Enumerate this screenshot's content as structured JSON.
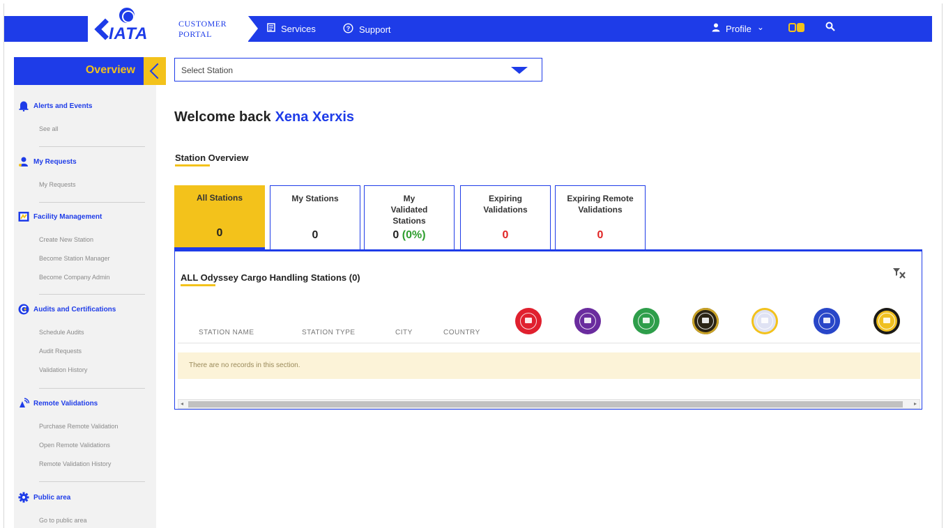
{
  "header": {
    "logo_text": "IATA",
    "portal_line1": "CUSTOMER",
    "portal_line2": "PORTAL",
    "nav": [
      {
        "label": "Services",
        "icon": "services-icon"
      },
      {
        "label": "Support",
        "icon": "help-circle-icon"
      }
    ],
    "profile_label": "Profile",
    "profile_chevron": "⌄",
    "colors": {
      "primary": "#1e3ce8",
      "accent": "#f3c21b"
    }
  },
  "sidebar": {
    "title": "Overview",
    "sections": [
      {
        "title": "Alerts and Events",
        "icon": "bell-icon",
        "items": [
          "See all"
        ]
      },
      {
        "title": "My Requests",
        "icon": "user-request-icon",
        "items": [
          "My Requests"
        ]
      },
      {
        "title": "Facility Management",
        "icon": "facility-icon",
        "items": [
          "Create New Station",
          "Become Station Manager",
          "Become Company Admin"
        ]
      },
      {
        "title": "Audits and Certifications",
        "icon": "audit-icon",
        "items": [
          "Schedule Audits",
          "Audit Requests",
          "Validation History"
        ]
      },
      {
        "title": "Remote Validations",
        "icon": "remote-validation-icon",
        "items": [
          "Purchase Remote Validation",
          "Open Remote Validations",
          "Remote Validation History"
        ]
      },
      {
        "title": "Public area",
        "icon": "gear-icon",
        "items": [
          "Go to public area"
        ]
      }
    ]
  },
  "main": {
    "station_select": {
      "value": "Select Station"
    },
    "welcome": {
      "prefix": "Welcome back",
      "name": "Xena Xerxis"
    },
    "station_overview_label": "Station Overview",
    "cards": [
      {
        "label": "All Stations",
        "value": "0",
        "value_color": "#222222",
        "active": true
      },
      {
        "label": "My Stations",
        "value": "0",
        "value_color": "#222222",
        "active": false
      },
      {
        "label": "My Validated Stations",
        "value": "0",
        "value_suffix": "(0%)",
        "value_color": "#222222",
        "suffix_color": "#2e9e2e",
        "active": false
      },
      {
        "label": "Expiring Validations",
        "value": "0",
        "value_color": "#e02424",
        "active": false
      },
      {
        "label": "Expiring Remote Validations",
        "value": "0",
        "value_color": "#e02424",
        "active": false
      }
    ],
    "table": {
      "title": "ALL Odyssey Cargo Handling Stations (0)",
      "columns": [
        "STATION NAME",
        "STATION TYPE",
        "CITY",
        "COUNTRY"
      ],
      "seals": [
        {
          "name": "red-seal-icon",
          "color": "#e0202e"
        },
        {
          "name": "purple-seal-icon",
          "color": "#6a2c9e"
        },
        {
          "name": "green-seal-icon",
          "color": "#2e9e4a"
        },
        {
          "name": "black-gold-seal-icon",
          "color": "#2b2414"
        },
        {
          "name": "light-seal-icon",
          "color": "#dfe2f3"
        },
        {
          "name": "blue-seal-icon",
          "color": "#2846c8"
        },
        {
          "name": "yellow-black-seal-icon",
          "color": "#f0c020"
        }
      ],
      "empty_message": "There are no records in this section."
    }
  }
}
